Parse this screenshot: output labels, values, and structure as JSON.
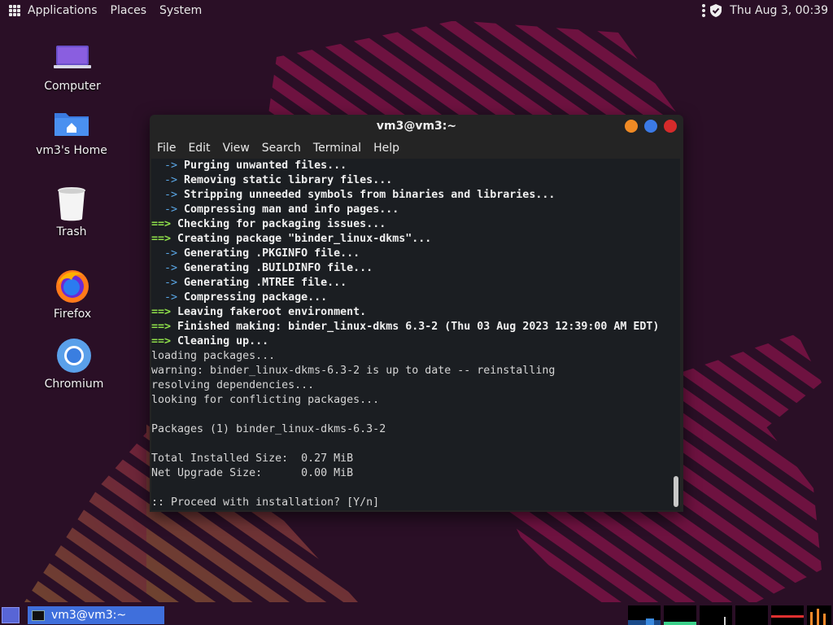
{
  "top_panel": {
    "menus": [
      "Applications",
      "Places",
      "System"
    ],
    "clock": "Thu Aug  3, 00:39"
  },
  "desktop_icons": [
    {
      "label": "Computer"
    },
    {
      "label": "vm3's Home"
    },
    {
      "label": "Trash"
    },
    {
      "label": "Firefox"
    },
    {
      "label": "Chromium"
    }
  ],
  "terminal": {
    "title": "vm3@vm3:~",
    "menu": [
      "File",
      "Edit",
      "View",
      "Search",
      "Terminal",
      "Help"
    ],
    "lines": [
      {
        "prefix": "  -> ",
        "kind": "blue",
        "text": "Purging unwanted files...",
        "bold": true
      },
      {
        "prefix": "  -> ",
        "kind": "blue",
        "text": "Removing static library files...",
        "bold": true
      },
      {
        "prefix": "  -> ",
        "kind": "blue",
        "text": "Stripping unneeded symbols from binaries and libraries...",
        "bold": true
      },
      {
        "prefix": "  -> ",
        "kind": "blue",
        "text": "Compressing man and info pages...",
        "bold": true
      },
      {
        "prefix": "==> ",
        "kind": "green",
        "text": "Checking for packaging issues...",
        "bold": true
      },
      {
        "prefix": "==> ",
        "kind": "green",
        "text": "Creating package \"binder_linux-dkms\"...",
        "bold": true
      },
      {
        "prefix": "  -> ",
        "kind": "blue",
        "text": "Generating .PKGINFO file...",
        "bold": true
      },
      {
        "prefix": "  -> ",
        "kind": "blue",
        "text": "Generating .BUILDINFO file...",
        "bold": true
      },
      {
        "prefix": "  -> ",
        "kind": "blue",
        "text": "Generating .MTREE file...",
        "bold": true
      },
      {
        "prefix": "  -> ",
        "kind": "blue",
        "text": "Compressing package...",
        "bold": true
      },
      {
        "prefix": "==> ",
        "kind": "green",
        "text": "Leaving fakeroot environment.",
        "bold": true
      },
      {
        "prefix": "==> ",
        "kind": "green",
        "text": "Finished making: binder_linux-dkms 6.3-2 (Thu 03 Aug 2023 12:39:00 AM EDT)",
        "bold": true
      },
      {
        "prefix": "==> ",
        "kind": "green",
        "text": "Cleaning up...",
        "bold": true
      },
      {
        "prefix": "",
        "kind": "plain",
        "text": "loading packages...",
        "bold": false
      },
      {
        "prefix": "",
        "kind": "plain",
        "text": "warning: binder_linux-dkms-6.3-2 is up to date -- reinstalling",
        "bold": false
      },
      {
        "prefix": "",
        "kind": "plain",
        "text": "resolving dependencies...",
        "bold": false
      },
      {
        "prefix": "",
        "kind": "plain",
        "text": "looking for conflicting packages...",
        "bold": false
      },
      {
        "prefix": "",
        "kind": "plain",
        "text": "",
        "bold": false
      },
      {
        "prefix": "",
        "kind": "plain",
        "text": "Packages (1) binder_linux-dkms-6.3-2",
        "bold": false
      },
      {
        "prefix": "",
        "kind": "plain",
        "text": "",
        "bold": false
      },
      {
        "prefix": "",
        "kind": "plain",
        "text": "Total Installed Size:  0.27 MiB",
        "bold": false
      },
      {
        "prefix": "",
        "kind": "plain",
        "text": "Net Upgrade Size:      0.00 MiB",
        "bold": false
      },
      {
        "prefix": "",
        "kind": "plain",
        "text": "",
        "bold": false
      },
      {
        "prefix": "",
        "kind": "plain",
        "text": ":: Proceed with installation? [Y/n]",
        "bold": false
      }
    ]
  },
  "bottom_panel": {
    "task_label": "vm3@vm3:~"
  },
  "colors": {
    "wallpaper_bg": "#2a0f26",
    "stripe_pink": "#ff1a7a",
    "stripe_orange": "#ff8a3a",
    "btn_minimize": "#f08a24",
    "btn_maximize": "#3b7ae6",
    "btn_close": "#d62b2b"
  }
}
